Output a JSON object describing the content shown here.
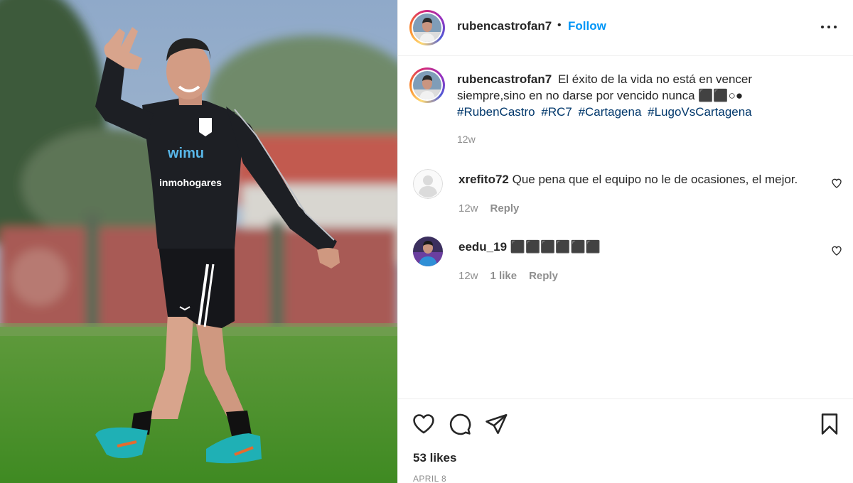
{
  "post": {
    "author": "rubencastrofan7",
    "follow_label": "Follow",
    "separator": "•",
    "caption_text": "El éxito de la vida no está en vencer siempre,sino en no darse por vencido nunca ⬛⬛○●",
    "hashtags": [
      "#RubenCastro",
      "#RC7",
      "#Cartagena",
      "#LugoVsCartagena"
    ],
    "caption_time": "12w",
    "likes": "53 likes",
    "date": "APRIL 8"
  },
  "photo": {
    "jersey_sponsor_top": "wimu",
    "jersey_sponsor_bottom": "inmohogares"
  },
  "comments": [
    {
      "user": "xrefito72",
      "text": "Que pena que el equipo no le de ocasiones, el mejor.",
      "time": "12w",
      "likes": "",
      "reply": "Reply"
    },
    {
      "user": "eedu_19",
      "text": "⬛⬛⬛⬛⬛⬛",
      "time": "12w",
      "likes": "1 like",
      "reply": "Reply"
    }
  ],
  "icons": {
    "more": "more-options-icon",
    "like": "heart-icon",
    "comment": "comment-icon",
    "share": "share-icon",
    "save": "bookmark-icon"
  },
  "colors": {
    "follow": "#0095f6",
    "hashtag": "#00376b",
    "muted": "#8e8e8e",
    "text": "#262626"
  }
}
